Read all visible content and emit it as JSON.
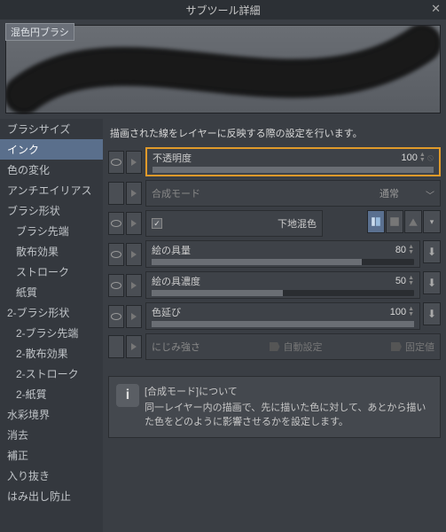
{
  "title": "サブツール詳細",
  "brush_name": "混色円ブラシ",
  "sidebar": {
    "items": [
      {
        "label": "ブラシサイズ"
      },
      {
        "label": "インク",
        "selected": true
      },
      {
        "label": "色の変化"
      },
      {
        "label": "アンチエイリアス"
      },
      {
        "label": "ブラシ形状"
      },
      {
        "label": "ブラシ先端",
        "sub": true
      },
      {
        "label": "散布効果",
        "sub": true
      },
      {
        "label": "ストローク",
        "sub": true
      },
      {
        "label": "紙質",
        "sub": true
      },
      {
        "label": "2-ブラシ形状"
      },
      {
        "label": "2-ブラシ先端",
        "sub": true
      },
      {
        "label": "2-散布効果",
        "sub": true
      },
      {
        "label": "2-ストローク",
        "sub": true
      },
      {
        "label": "2-紙質",
        "sub": true
      },
      {
        "label": "水彩境界"
      },
      {
        "label": "消去"
      },
      {
        "label": "補正"
      },
      {
        "label": "入り抜き"
      },
      {
        "label": "はみ出し防止"
      }
    ]
  },
  "content": {
    "description": "描画された線をレイヤーに反映する際の設定を行います。",
    "opacity": {
      "label": "不透明度",
      "value": "100",
      "pct": 100
    },
    "blend": {
      "label": "合成モード",
      "value": "通常"
    },
    "mix": {
      "label": "下地混色",
      "checked": true
    },
    "paint_amount": {
      "label": "絵の具量",
      "value": "80",
      "pct": 80
    },
    "paint_density": {
      "label": "絵の具濃度",
      "value": "50",
      "pct": 50
    },
    "color_stretch": {
      "label": "色延び",
      "value": "100",
      "pct": 100
    },
    "nijimi": {
      "label": "にじみ強さ",
      "auto": "自動設定",
      "fixed": "固定値"
    },
    "info": {
      "title": "[合成モード]について",
      "body": "同一レイヤー内の描画で、先に描いた色に対して、あとから描いた色をどのように影響させるかを設定します。"
    }
  }
}
